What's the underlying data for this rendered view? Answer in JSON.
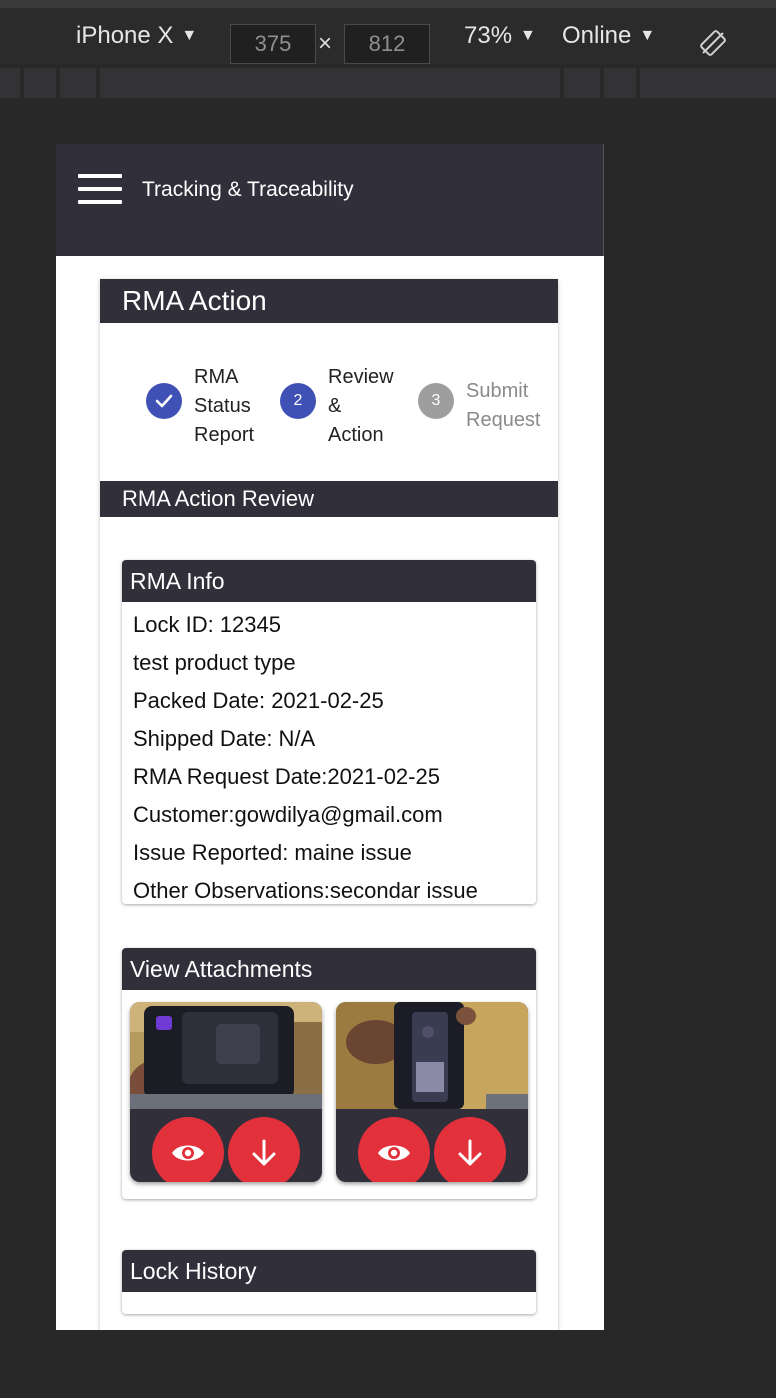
{
  "devtools": {
    "device": "iPhone X",
    "width": "375",
    "height": "812",
    "zoom": "73%",
    "network": "Online",
    "times_symbol": "×"
  },
  "app": {
    "title": "Tracking & Traceability",
    "header_color": "#302f3a"
  },
  "panel": {
    "title": "RMA Action",
    "steps": [
      {
        "number": "✓",
        "lines": [
          "RMA",
          "Status",
          "Report"
        ],
        "state": "completed",
        "color": "#3f51b5"
      },
      {
        "number": "2",
        "lines": [
          "Review",
          "&",
          "Action"
        ],
        "state": "active",
        "color": "#3f51b5"
      },
      {
        "number": "3",
        "lines": [
          "Submit",
          "Request"
        ],
        "state": "inactive",
        "color": "#9e9e9e"
      }
    ],
    "section_title": "RMA Action Review"
  },
  "rma_info": {
    "title": "RMA Info",
    "lines": [
      "Lock ID: 12345",
      "test product type",
      "Packed Date: 2021-02-25",
      "Shipped Date: N/A",
      "RMA Request Date:2021-02-25",
      "Customer:gowdilya@gmail.com",
      "Issue Reported: maine issue",
      "Other Observations:secondar issue"
    ]
  },
  "attachments": {
    "title": "View Attachments",
    "items": [
      {
        "view_icon": "eye-icon",
        "download_icon": "arrow-down-icon"
      },
      {
        "view_icon": "eye-icon",
        "download_icon": "arrow-down-icon"
      }
    ],
    "button_color": "#e3313c"
  },
  "lock_history": {
    "title": "Lock History"
  }
}
